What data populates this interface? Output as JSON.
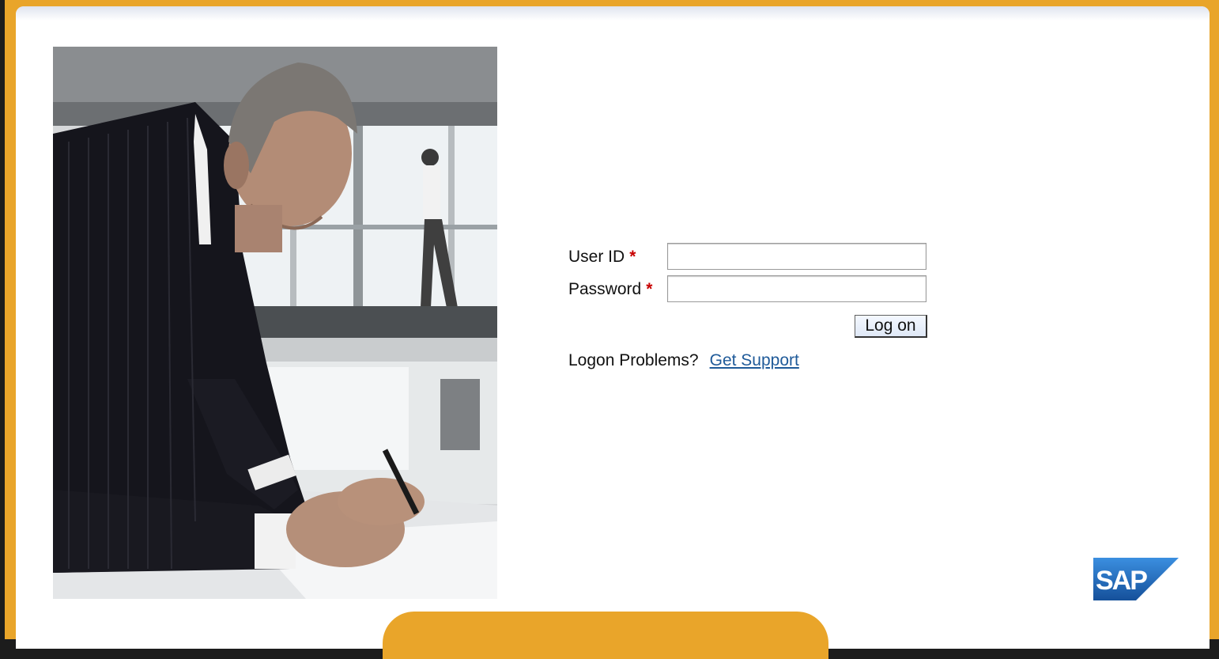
{
  "login": {
    "user_id_label": "User ID",
    "password_label": "Password",
    "required_marker": "*",
    "user_id_value": "",
    "password_value": "",
    "logon_button": "Log on",
    "problems_text": "Logon Problems?",
    "support_link": "Get Support"
  },
  "branding": {
    "logo_text": "SAP",
    "frame_color": "#e9a52a",
    "logo_color": "#1a5fb4",
    "link_color": "#1f5a99"
  },
  "image": {
    "description_icon": "businessman-photo"
  }
}
